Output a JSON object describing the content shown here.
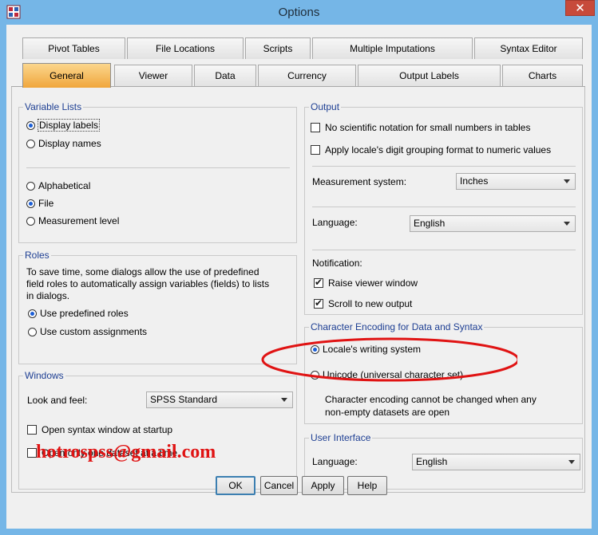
{
  "window": {
    "title": "Options",
    "close_label": "✕"
  },
  "tabs": {
    "row1": [
      "Pivot Tables",
      "File Locations",
      "Scripts",
      "Multiple Imputations",
      "Syntax Editor"
    ],
    "row2": [
      "General",
      "Viewer",
      "Data",
      "Currency",
      "Output Labels",
      "Charts"
    ],
    "active": "General"
  },
  "variable_lists": {
    "title": "Variable Lists",
    "display_labels": "Display labels",
    "display_names": "Display names",
    "alphabetical": "Alphabetical",
    "file": "File",
    "measurement_level": "Measurement level",
    "display_selected": "Display labels",
    "order_selected": "File"
  },
  "roles": {
    "title": "Roles",
    "description": "To save time, some dialogs allow the use of predefined field roles to automatically assign variables (fields) to lists in dialogs.",
    "line1": "To save time, some dialogs allow the use of predefined",
    "line2": "field roles to automatically assign variables (fields) to lists",
    "line3": "in dialogs.",
    "use_predefined": "Use predefined roles",
    "use_custom": "Use custom assignments",
    "selected": "Use predefined roles"
  },
  "windows": {
    "title": "Windows",
    "look_feel_label": "Look and feel:",
    "look_feel_value": "SPSS Standard",
    "open_syntax": "Open syntax window at startup",
    "open_syntax_checked": false,
    "open_one_dataset": "Open only one dataset at a time",
    "open_one_dataset_checked": false
  },
  "output": {
    "title": "Output",
    "no_scientific": "No scientific notation for small numbers in tables",
    "no_scientific_checked": false,
    "apply_locale": "Apply locale's digit  grouping format to numeric values",
    "apply_locale_checked": false,
    "measurement_label": "Measurement system:",
    "measurement_value": "Inches",
    "language_label": "Language:",
    "language_value": "English",
    "notification_label": "Notification:",
    "raise_viewer": "Raise viewer window",
    "raise_viewer_checked": true,
    "scroll_new": "Scroll to new output",
    "scroll_new_checked": true
  },
  "encoding": {
    "title": "Character Encoding for Data and Syntax",
    "locale_writing": "Locale's writing system",
    "unicode": "Unicode (universal character set)",
    "selected": "Locale's writing system",
    "note_line1": "Character encoding cannot be changed when any",
    "note_line2": "non-empty datasets are open"
  },
  "user_interface": {
    "title": "User Interface",
    "language_label": "Language:",
    "language_value": "English"
  },
  "watermark": "hotrospss@gmail.com",
  "buttons": {
    "ok": "OK",
    "cancel": "Cancel",
    "apply": "Apply",
    "help": "Help"
  },
  "colors": {
    "title_bar": "#75b6e7",
    "active_tab": "#f0a63c",
    "group_title": "#1e3f93",
    "annotation": "#e01313"
  }
}
